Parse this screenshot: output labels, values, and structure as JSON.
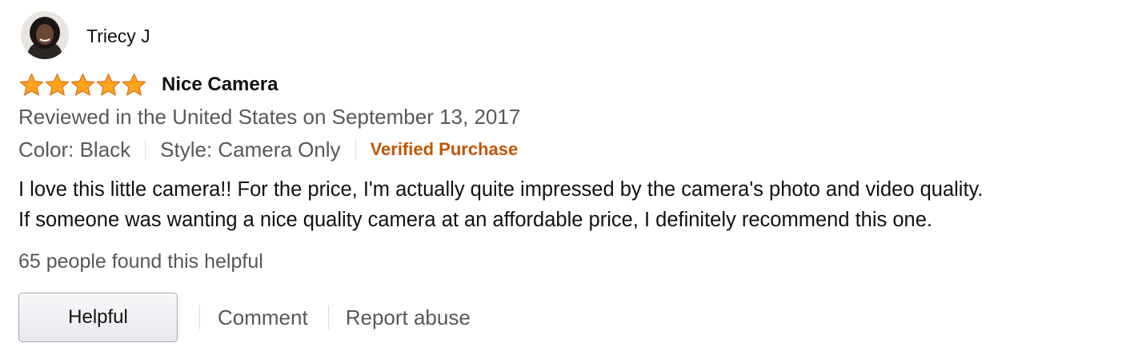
{
  "reviewer": {
    "name": "Triecy J",
    "avatar_icon": "user-avatar-photo"
  },
  "rating": {
    "stars": 5,
    "max_stars": 5,
    "star_color": "#ffa41c",
    "star_outline_color": "#de7921"
  },
  "review": {
    "title": "Nice Camera",
    "date_line": "Reviewed in the United States on September 13, 2017",
    "format": {
      "color": "Color: Black",
      "style": "Style: Camera Only"
    },
    "verified_label": "Verified Purchase",
    "verified_color": "#c45500",
    "body_lines": [
      "I love this little camera!! For the price, I'm actually quite impressed by the camera's photo and video quality.",
      "If someone was wanting a nice quality camera at an affordable price, I definitely recommend this one."
    ],
    "helpful_count_text": "65 people found this helpful"
  },
  "actions": {
    "helpful_label": "Helpful",
    "comment_label": "Comment",
    "report_label": "Report abuse"
  }
}
